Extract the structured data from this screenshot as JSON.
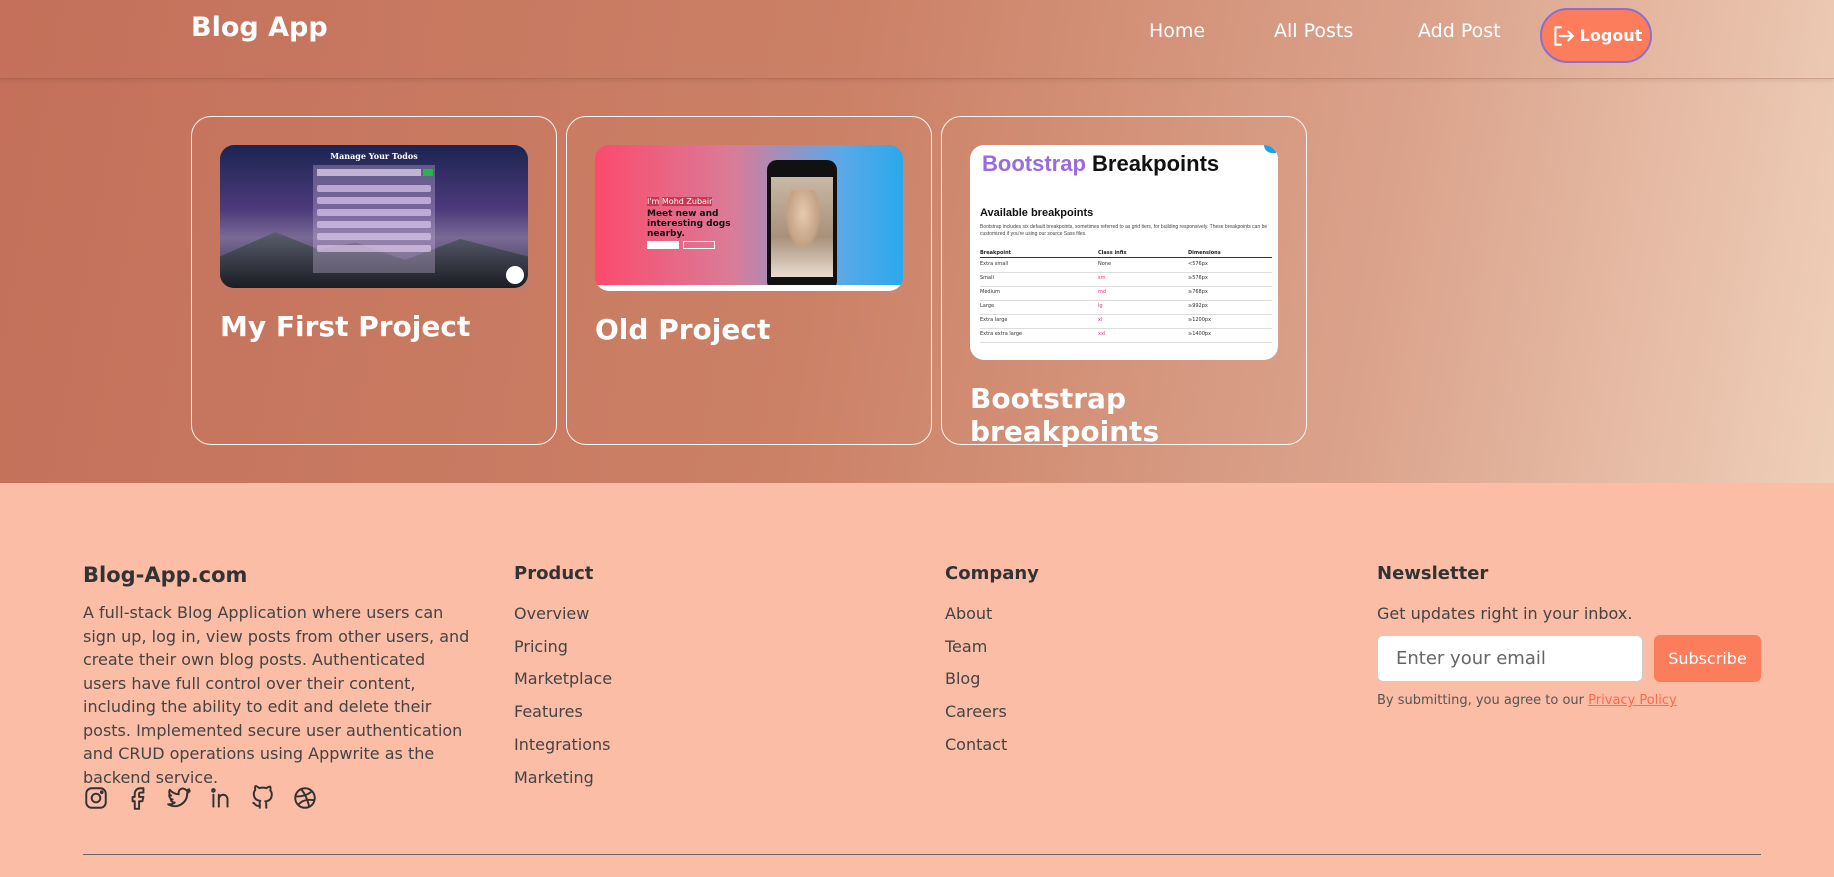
{
  "header": {
    "brand": "Blog App",
    "nav": [
      {
        "label": "Home"
      },
      {
        "label": "All Posts"
      },
      {
        "label": "Add Post"
      }
    ],
    "logout_label": "Logout"
  },
  "posts": [
    {
      "title": "My First Project",
      "thumb_caption": "Manage Your Todos"
    },
    {
      "title": "Old Project",
      "thumb_name": "Mohd Zubair",
      "thumb_intro": "I'm",
      "thumb_headline": "Meet new and interesting dogs nearby."
    },
    {
      "title": "Bootstrap breakpoints",
      "thumb_title_accent": "Bootstrap",
      "thumb_title_rest": "Breakpoints",
      "thumb_subtitle": "Available breakpoints",
      "thumb_desc": "Bootstrap includes six default breakpoints, sometimes referred to as grid tiers, for building responsively. These breakpoints can be customized if you're using our source Sass files.",
      "thumb_headers": [
        "Breakpoint",
        "Class infix",
        "Dimensions"
      ],
      "thumb_rows": [
        [
          "Extra small",
          "None",
          "<576px"
        ],
        [
          "Small",
          "sm",
          "≥576px"
        ],
        [
          "Medium",
          "md",
          "≥768px"
        ],
        [
          "Large",
          "lg",
          "≥992px"
        ],
        [
          "Extra large",
          "xl",
          "≥1200px"
        ],
        [
          "Extra extra large",
          "xxl",
          "≥1400px"
        ]
      ]
    }
  ],
  "footer": {
    "brand": "Blog-App.com",
    "about": "A full-stack Blog Application where users can sign up, log in, view posts from other users, and create their own blog posts. Authenticated users have full control over their content, including the ability to edit and delete their posts. Implemented secure user authentication and CRUD operations using Appwrite as the backend service.",
    "social_icons": [
      "instagram-icon",
      "facebook-icon",
      "twitter-icon",
      "linkedin-icon",
      "github-icon",
      "dribbble-icon"
    ],
    "product": {
      "heading": "Product",
      "links": [
        "Overview",
        "Pricing",
        "Marketplace",
        "Features",
        "Integrations",
        "Marketing"
      ]
    },
    "company": {
      "heading": "Company",
      "links": [
        "About",
        "Team",
        "Blog",
        "Careers",
        "Contact"
      ]
    },
    "newsletter": {
      "heading": "Newsletter",
      "text": "Get updates right in your inbox.",
      "placeholder": "Enter your email",
      "button": "Subscribe",
      "terms_prefix": "By submitting, you agree to our",
      "terms_link": "Privacy Policy"
    }
  },
  "colors": {
    "accent": "#fb7d5c",
    "footer_bg": "#fbbda6",
    "header_gradient_start": "#c4705a",
    "header_gradient_end": "#efcfb9"
  }
}
